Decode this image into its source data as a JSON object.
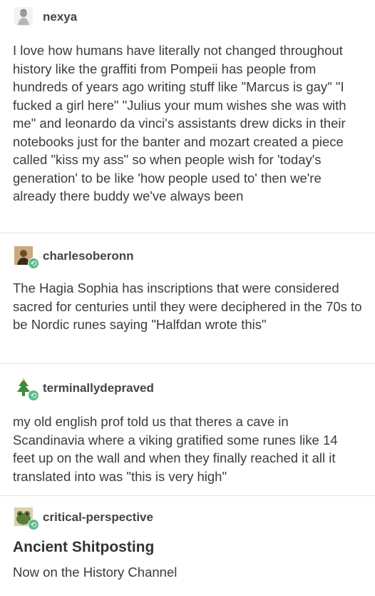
{
  "posts": [
    {
      "username": "nexya",
      "avatar_icon": "statue-icon",
      "text": "I love how humans have literally not changed throughout history like the graffiti from Pompeii has people from hundreds of years ago writing stuff like \"Marcus is gay\" \"I fucked a girl here\" \"Julius your mum wishes she was with me\" and leonardo da vinci's assistants drew dicks in their notebooks just for the banter and mozart created a piece called \"kiss my ass\" so when people wish for 'today's generation' to be like 'how people used to' then we're already there buddy we've always been"
    },
    {
      "username": "charlesoberonn",
      "avatar_icon": "portrait-icon",
      "reblog_icon": "reblog-icon",
      "text": "The Hagia Sophia has inscriptions that were considered sacred for centuries until they were deciphered in the 70s to be Nordic runes saying \"Halfdan wrote this\""
    },
    {
      "username": "terminallydepraved",
      "avatar_icon": "tree-icon",
      "reblog_icon": "reblog-icon",
      "text": "my old english prof told us that theres a cave in Scandinavia where a viking gratified some runes like 14 feet up on the wall and when they finally reached it all it translated into was \"this is very high\""
    },
    {
      "username": "critical-perspective",
      "avatar_icon": "frog-icon",
      "reblog_icon": "reblog-icon",
      "heading": "Ancient Shitposting",
      "text": "Now on the History Channel"
    }
  ],
  "colors": {
    "reblog_badge": "#56bc8a",
    "text": "#3c3c3c"
  }
}
